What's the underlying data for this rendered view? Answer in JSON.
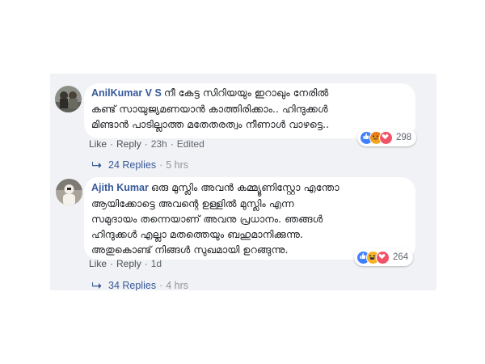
{
  "colors": {
    "thread_bg": "#f1f2f5",
    "link": "#365899",
    "like": "#4080ff",
    "love": "#f25268",
    "haha": "#f7b125"
  },
  "comments": [
    {
      "author": "AnilKumar V S",
      "text_lines": [
        "നീ കേട്ട സിറിയയും ഇറാഖും നേരിൽ",
        "കണ്ട് സായുജ്യമണയാൻ കാത്തിരിക്കാം.. ഹിന്ദുക്കൾ",
        "മിണ്ടാൻ പാടില്ലാത്ത മതേതരത്വം നീണാൾ വാഴട്ടെ.."
      ],
      "actions": {
        "like": "Like",
        "reply": "Reply",
        "time": "23h",
        "edited": "Edited"
      },
      "reactions": {
        "icons": [
          "like-icon",
          "angry-icon",
          "love-icon"
        ],
        "count": "298"
      },
      "replies": {
        "label": "24 Replies",
        "time": "5 hrs"
      }
    },
    {
      "author": "Ajith Kumar",
      "text_lines": [
        "ഒരു മുസ്ലിം അവൻ കമ്മ്യൂണിസ്റ്റോ എന്തോ",
        "ആയിക്കോട്ടെ അവന്റെ ഉള്ളിൽ മുസ്ലിം എന്ന",
        "സമുദായം തന്നെയാണ് അവനു പ്രധാനം. ഞങ്ങൾ",
        "ഹിന്ദുക്കൾ എല്ലാ മതത്തെയും ബഹുമാനിക്കുന്നു.",
        "അതുകൊണ്ട് നിങ്ങൾ സുഖമായി ഉറങ്ങുന്നു."
      ],
      "actions": {
        "like": "Like",
        "reply": "Reply",
        "time": "1d"
      },
      "reactions": {
        "icons": [
          "like-icon",
          "haha-icon",
          "love-icon"
        ],
        "count": "264"
      },
      "replies": {
        "label": "34 Replies",
        "time": "4 hrs"
      }
    }
  ]
}
